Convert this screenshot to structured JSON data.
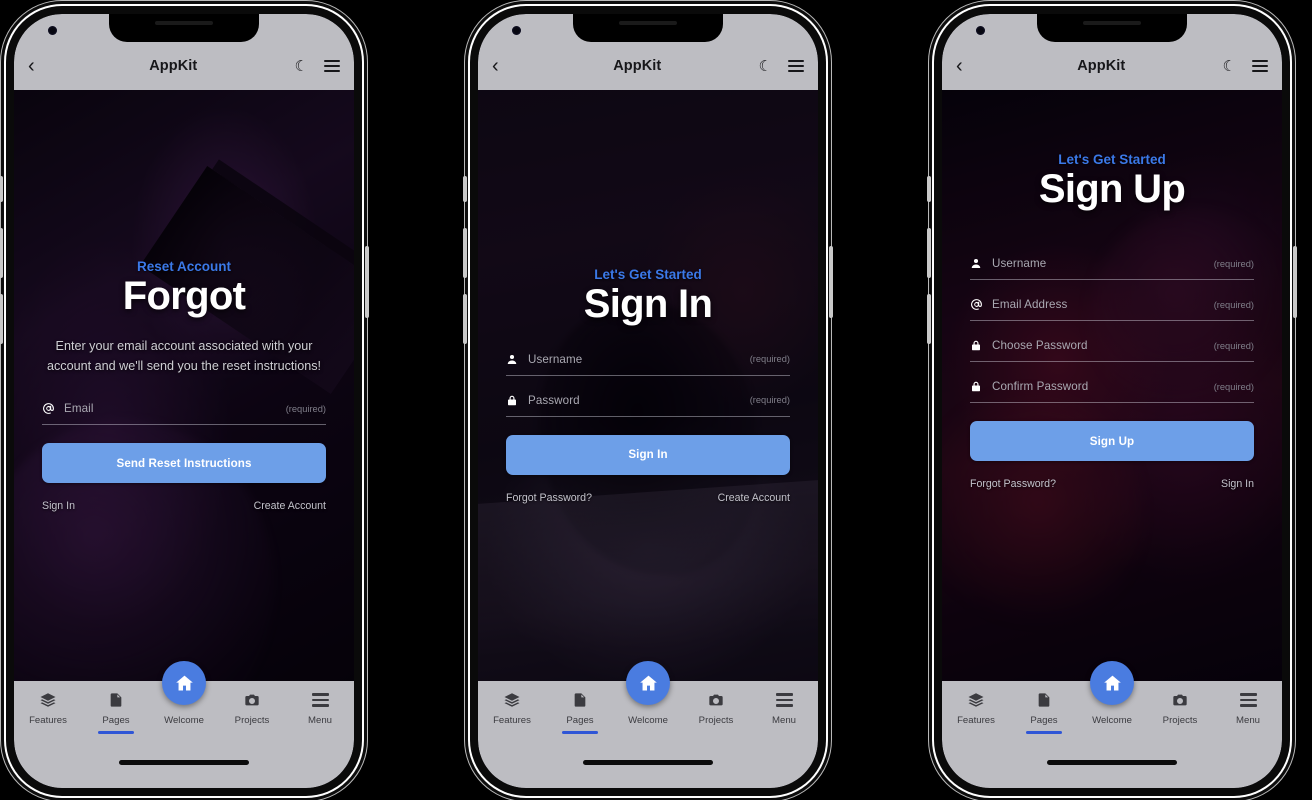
{
  "appbar": {
    "back_icon": "chevron-left-icon",
    "title": "AppKit",
    "moon_icon": "moon-icon",
    "menu_icon": "hamburger-menu-icon"
  },
  "colors": {
    "accent_blue": "#3b79e8",
    "button_blue": "#6d9fe8",
    "fab_blue": "#4a7ce0",
    "underline_blue": "#2f56d6",
    "bar_gray": "#bdbdc2"
  },
  "required_note": "(required)",
  "tabs": [
    {
      "label": "Features",
      "icon": "layers-icon",
      "active": false
    },
    {
      "label": "Pages",
      "icon": "document-icon",
      "active": true
    },
    {
      "label": "Welcome",
      "icon": "home-icon",
      "active": false
    },
    {
      "label": "Projects",
      "icon": "camera-icon",
      "active": false
    },
    {
      "label": "Menu",
      "icon": "hamburger-menu-icon",
      "active": false
    }
  ],
  "phones": [
    {
      "name": "forgot-password",
      "eyebrow": "Reset Account",
      "headline": "Forgot",
      "blurb": "Enter your email account associated with your account and we'll send you the reset instructions!",
      "fields": [
        {
          "label": "Email",
          "icon": "at-sign-icon",
          "required": "(required)"
        }
      ],
      "cta": "Send Reset Instructions",
      "link_left": "Sign In",
      "link_right": "Create Account"
    },
    {
      "name": "sign-in",
      "eyebrow": "Let's Get Started",
      "headline": "Sign In",
      "blurb": "",
      "fields": [
        {
          "label": "Username",
          "icon": "person-icon",
          "required": "(required)"
        },
        {
          "label": "Password",
          "icon": "lock-icon",
          "required": "(required)"
        }
      ],
      "cta": "Sign In",
      "link_left": "Forgot Password?",
      "link_right": "Create Account"
    },
    {
      "name": "sign-up",
      "eyebrow": "Let's Get Started",
      "headline": "Sign Up",
      "blurb": "",
      "fields": [
        {
          "label": "Username",
          "icon": "person-icon",
          "required": "(required)"
        },
        {
          "label": "Email Address",
          "icon": "at-sign-icon",
          "required": "(required)"
        },
        {
          "label": "Choose Password",
          "icon": "lock-icon",
          "required": "(required)"
        },
        {
          "label": "Confirm Password",
          "icon": "lock-icon",
          "required": "(required)"
        }
      ],
      "cta": "Sign Up",
      "link_left": "Forgot Password?",
      "link_right": "Sign In"
    }
  ]
}
